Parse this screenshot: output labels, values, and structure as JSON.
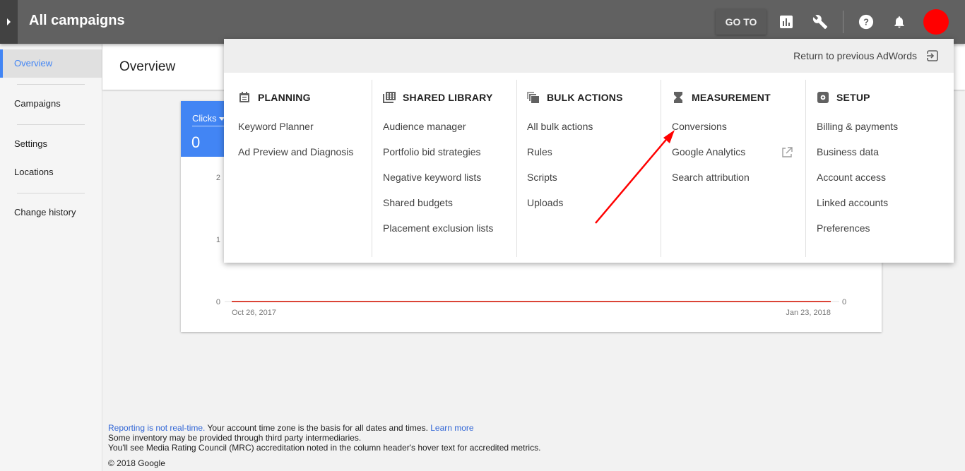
{
  "topbar": {
    "title": "All campaigns",
    "goto_label": "GO TO",
    "icons": [
      "reports-icon",
      "tools-wrench-icon",
      "help-icon",
      "notifications-bell-icon"
    ]
  },
  "sidebar": {
    "items": [
      {
        "label": "Overview",
        "active": true
      },
      {
        "label": "Campaigns"
      },
      {
        "label": "Settings"
      },
      {
        "label": "Locations"
      },
      {
        "label": "Change history"
      }
    ]
  },
  "page": {
    "title": "Overview"
  },
  "metric_card": {
    "label": "Clicks",
    "value": "0",
    "accent": "#4285f4"
  },
  "chart_data": {
    "type": "line",
    "title": "",
    "series": [
      {
        "name": "Clicks",
        "color": "#db4437",
        "x": [
          "Oct 26, 2017",
          "Jan 23, 2018"
        ],
        "values": [
          0,
          0
        ]
      }
    ],
    "x_tick_labels": [
      "Oct 26, 2017",
      "Jan 23, 2018"
    ],
    "y_tick_labels": [
      "0",
      "1",
      "2"
    ],
    "y_right_tick_labels": [
      "0"
    ],
    "ylim": [
      0,
      2
    ],
    "grid": false
  },
  "megamenu": {
    "return_label": "Return to previous AdWords",
    "columns": [
      {
        "title": "PLANNING",
        "icon": "calendar-icon",
        "items": [
          "Keyword Planner",
          "Ad Preview and Diagnosis"
        ]
      },
      {
        "title": "SHARED LIBRARY",
        "icon": "library-icon",
        "items": [
          "Audience manager",
          "Portfolio bid strategies",
          "Negative keyword lists",
          "Shared budgets",
          "Placement exclusion lists"
        ]
      },
      {
        "title": "BULK ACTIONS",
        "icon": "bulk-copy-icon",
        "items": [
          "All bulk actions",
          "Rules",
          "Scripts",
          "Uploads"
        ]
      },
      {
        "title": "MEASUREMENT",
        "icon": "hourglass-icon",
        "items": [
          "Conversions",
          "Google Analytics",
          "Search attribution"
        ]
      },
      {
        "title": "SETUP",
        "icon": "settings-box-icon",
        "items": [
          "Billing & payments",
          "Business data",
          "Account access",
          "Linked accounts",
          "Preferences"
        ]
      }
    ]
  },
  "footer": {
    "link1": "Reporting is not real-time.",
    "text1": " Your account time zone is the basis for all dates and times. ",
    "link2": "Learn more",
    "line2": "Some inventory may be provided through third party intermediaries.",
    "line3": "You'll see Media Rating Council (MRC) accreditation noted in the column header's hover text for accredited metrics.",
    "copyright": "© 2018 Google"
  }
}
